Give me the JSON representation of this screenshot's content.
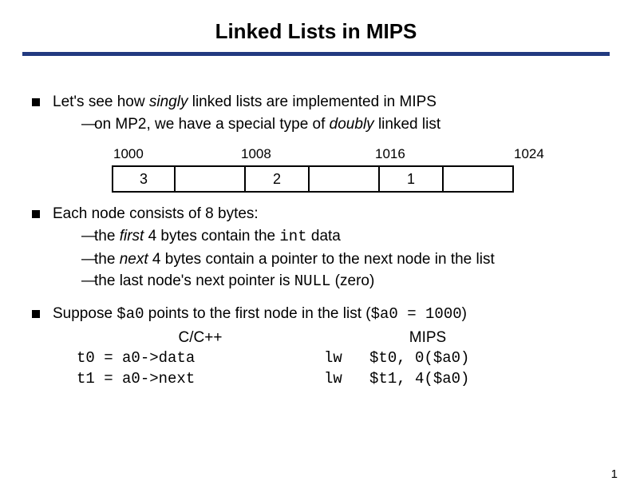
{
  "title": "Linked Lists in MIPS",
  "b1": {
    "line1a": "Let's see how ",
    "line1b": "singly",
    "line1c": " linked lists are implemented in MIPS",
    "sub1a": "on MP2, we have a special type of ",
    "sub1b": "doubly",
    "sub1c": " linked list"
  },
  "addresses": {
    "a0": "1000",
    "a1": "1008",
    "a2": "1016",
    "a3": "1024"
  },
  "nodes": {
    "d0": "3",
    "d1": "2",
    "d2": "1"
  },
  "b2": {
    "head": "Each node consists of 8 bytes:",
    "s1a": "the ",
    "s1b": "first",
    "s1c": " 4 bytes contain the ",
    "s1d": "int",
    "s1e": " data",
    "s2a": "the ",
    "s2b": "next",
    "s2c": " 4 bytes contain a pointer to the next node in the list",
    "s3a": "the last node's next pointer is ",
    "s3b": "NULL",
    "s3c": " (zero)"
  },
  "b3": {
    "texta": "Suppose ",
    "reg": "$a0",
    "textb": " points to the first node in the list  (",
    "eq": "$a0 = 1000",
    "textc": ")"
  },
  "code": {
    "leftHeader": "C/C++",
    "rightHeader": "MIPS",
    "l1": "t0 = a0->data",
    "l2": "t1 = a0->next",
    "r1": "lw   $t0, 0($a0)",
    "r2": "lw   $t1, 4($a0)"
  },
  "pagenum": "1"
}
